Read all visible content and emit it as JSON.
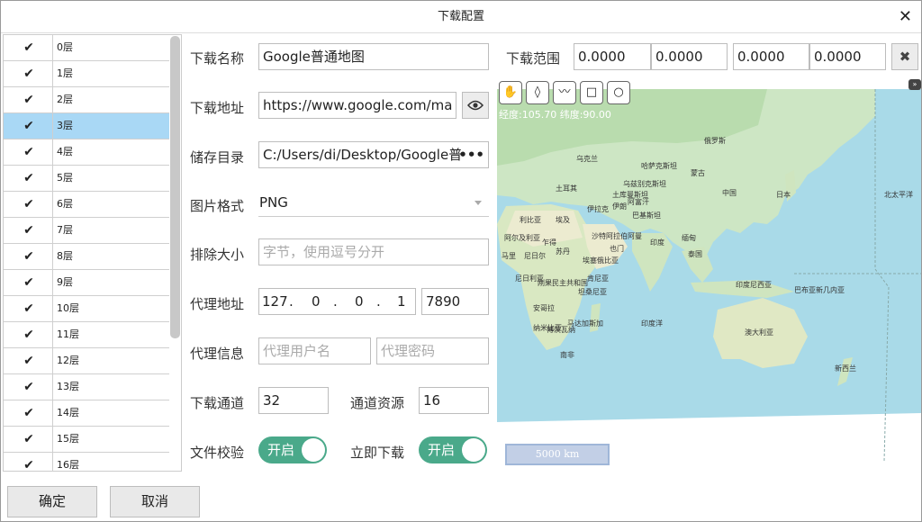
{
  "window": {
    "title": "下载配置",
    "close": "✕"
  },
  "levels": [
    {
      "label": "0层",
      "checked": true
    },
    {
      "label": "1层",
      "checked": true
    },
    {
      "label": "2层",
      "checked": true
    },
    {
      "label": "3层",
      "checked": true,
      "selected": true
    },
    {
      "label": "4层",
      "checked": true
    },
    {
      "label": "5层",
      "checked": true
    },
    {
      "label": "6层",
      "checked": true
    },
    {
      "label": "7层",
      "checked": true
    },
    {
      "label": "8层",
      "checked": true
    },
    {
      "label": "9层",
      "checked": true
    },
    {
      "label": "10层",
      "checked": true
    },
    {
      "label": "11层",
      "checked": true
    },
    {
      "label": "12层",
      "checked": true
    },
    {
      "label": "13层",
      "checked": true
    },
    {
      "label": "14层",
      "checked": true
    },
    {
      "label": "15层",
      "checked": true
    },
    {
      "label": "16层",
      "checked": true
    }
  ],
  "form": {
    "name_label": "下载名称",
    "name_value": "Google普通地图",
    "url_label": "下载地址",
    "url_value": "https://www.google.com/ma",
    "dir_label": "储存目录",
    "dir_value": "C:/Users/di/Desktop/Google普",
    "fmt_label": "图片格式",
    "fmt_value": "PNG",
    "exclude_label": "排除大小",
    "exclude_placeholder": "字节，使用逗号分开",
    "proxy_label": "代理地址",
    "proxy_ip": [
      "127",
      "0",
      "0",
      "1"
    ],
    "proxy_port": "7890",
    "proxy_info_label": "代理信息",
    "proxy_user_placeholder": "代理用户名",
    "proxy_pass_placeholder": "代理密码",
    "channels_label": "下载通道",
    "channels_value": "32",
    "res_label": "通道资源",
    "res_value": "16",
    "verify_label": "文件校验",
    "verify_toggle": "开启",
    "now_label": "立即下载",
    "now_toggle": "开启"
  },
  "range": {
    "label": "下载范围",
    "values": [
      "0.0000",
      "0.0000",
      "0.0000",
      "0.0000"
    ],
    "clear": "✖"
  },
  "map": {
    "coord": "经度:105.70 纬度:90.00",
    "scale": "5000 km",
    "labels": [
      "俄罗斯",
      "哈萨克斯坦",
      "蒙古",
      "中国",
      "日本",
      "土耳其",
      "伊拉克",
      "伊朗",
      "巴基斯坦",
      "印度",
      "沙特阿拉伯",
      "埃及",
      "利比亚",
      "阿尔及利亚",
      "苏丹",
      "尼日利亚",
      "埃塞俄比亚",
      "刚果民主共和国",
      "安哥拉",
      "纳米比亚",
      "南非",
      "马达加斯加",
      "印度洋",
      "印度尼西亚",
      "巴布亚新几内亚",
      "澳大利亚",
      "新西兰",
      "北太平洋",
      "乌克兰",
      "缅甸",
      "泰国",
      "肯尼亚",
      "坦桑尼亚",
      "博茨瓦纳",
      "也门",
      "阿曼",
      "乌兹别克斯坦",
      "土库曼斯坦",
      "阿富汗",
      "乍得",
      "尼日尔",
      "马里"
    ]
  },
  "buttons": {
    "ok": "确定",
    "cancel": "取消"
  }
}
